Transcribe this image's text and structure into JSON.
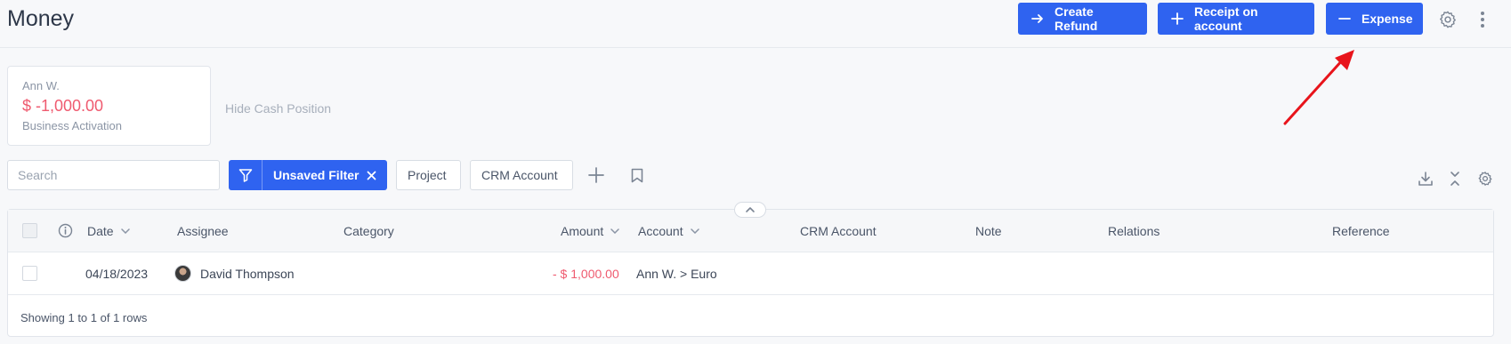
{
  "header": {
    "title": "Money",
    "buttons": {
      "create_refund": "Create Refund",
      "receipt_on_account": "Receipt on account",
      "expense": "Expense"
    }
  },
  "cash_position": {
    "name": "Ann W.",
    "amount": "$ -1,000.00",
    "subtitle": "Business Activation",
    "hide_label": "Hide Cash Position"
  },
  "toolbar": {
    "search_placeholder": "Search",
    "filter_label": "Unsaved Filter",
    "project_label": "Project",
    "crm_account_label": "CRM Account"
  },
  "table": {
    "columns": {
      "date": "Date",
      "assignee": "Assignee",
      "category": "Category",
      "amount": "Amount",
      "account": "Account",
      "crm_account": "CRM Account",
      "note": "Note",
      "relations": "Relations",
      "reference": "Reference"
    },
    "rows": [
      {
        "date": "04/18/2023",
        "assignee": "David Thompson",
        "category": "",
        "amount": "- $ 1,000.00",
        "account": "Ann W. > Euro",
        "crm_account": "",
        "note": "",
        "relations": "",
        "reference": ""
      }
    ],
    "footer": "Showing 1 to 1 of 1 rows"
  },
  "colors": {
    "primary": "#2f63f0",
    "negative": "#ef5a6f",
    "annotation_arrow": "#e8141b"
  }
}
